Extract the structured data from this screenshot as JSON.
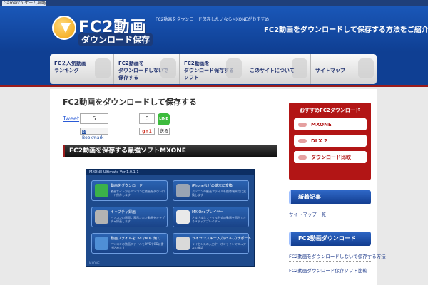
{
  "browser": {
    "tab_title": "Gamerch ゲーム攻略Wiki"
  },
  "header": {
    "logo_main": "FC2動画",
    "logo_sub": "ダウンロード保存",
    "tagline": "FC2動画をダウンロード保存したいならMXONEがおすすめ",
    "headline": "FC2動画をダウンロードして保存する方法をご紹介"
  },
  "nav": [
    {
      "label": "FC２人気動画\nランキング"
    },
    {
      "label": "FC2動画を\nダウンロードしないで\n保存する"
    },
    {
      "label": "FC2動画を\nダウンロード保存する\nソフト"
    },
    {
      "label": "このサイトについて"
    },
    {
      "label": "サイトマップ"
    }
  ],
  "article": {
    "title": "FC2動画をダウンロードして保存する",
    "tweet_label": "Tweet",
    "tweet_count": "5",
    "bookmark_label": "Bookmark",
    "gplus_count": "0",
    "gplus_label": "g+1",
    "line_label": "LINE",
    "okuru_label": "送る",
    "section_heading": "FC2動画を保存する最強ソフトMXONE"
  },
  "screenshot": {
    "title": "MXONE Ultimate Ver.1.0.1.1",
    "items": [
      {
        "label": "動画をダウンロード",
        "desc": "動画サイトからパソコンに動画をダウンロード保存します",
        "icon_color": "#3bb14a"
      },
      {
        "label": "iPhoneなどの端末に変換",
        "desc": "パソコンの動画ファイルを携帯端末用に変換します",
        "icon_color": "#9aa4b3"
      },
      {
        "label": "キャプチャ録画",
        "desc": "パソコンの画面に表示された動画をキャプチャ録画します",
        "icon_color": "#b3b3b3"
      },
      {
        "label": "MX Oneプレイヤー",
        "desc": "さまざまなファイル形式の動画を再生できるメディアプレイヤー",
        "icon_color": "#e9e9e9"
      },
      {
        "label": "動画ファイルをDVD/BDに焼く",
        "desc": "パソコンの動画ファイルをDVDやBDに書き込みます",
        "icon_color": "#4f8fd6"
      },
      {
        "label": "ライセンスキー入力/ヘルプ/サポート",
        "desc": "ライセンスの入力や、オンラインマニュアルの確認",
        "icon_color": "#d9d9d9"
      }
    ],
    "footer": "MXONE"
  },
  "sidebar": {
    "recommend_title": "おすすめFC2ダウンロード",
    "recommend_items": [
      "MXONE",
      "DLX 2",
      "ダウンロード比較"
    ],
    "block1_title": "新着記事",
    "block1_links": [
      "サイトマップ一覧"
    ],
    "block2_title": "FC2動画ダウンロード",
    "block2_links": [
      "FC2動画をダウンロードしないで保存する方法",
      "FC2動画ダウンロード保存ソフト比較"
    ]
  }
}
